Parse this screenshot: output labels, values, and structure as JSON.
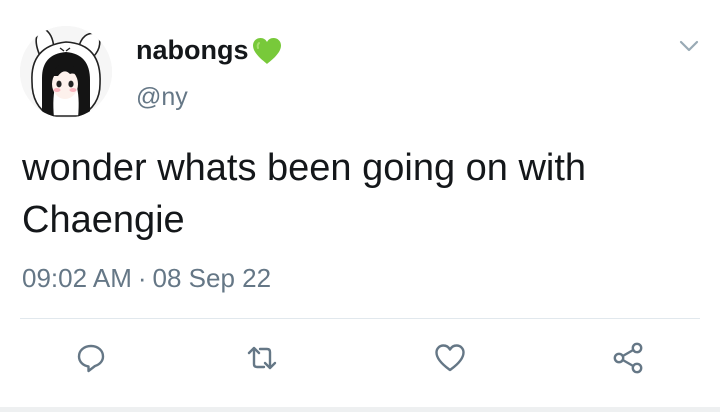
{
  "user": {
    "display_name": "nabongs",
    "handle": "@ny",
    "name_badge_icon": "green-heart-icon",
    "badge_color": "#78c93a"
  },
  "tweet": {
    "text_line1": "wonder whats been going on with",
    "text_line2": "Chaengie",
    "time": "09:02 AM",
    "separator": "·",
    "date": "08 Sep 22"
  },
  "actions": [
    {
      "name": "reply",
      "icon": "reply-icon"
    },
    {
      "name": "retweet",
      "icon": "retweet-icon"
    },
    {
      "name": "like",
      "icon": "heart-icon"
    },
    {
      "name": "share",
      "icon": "share-icon"
    }
  ],
  "colors": {
    "text": "#14171a",
    "secondary": "#657786",
    "icon": "#657786",
    "divider": "#e1e8ed"
  }
}
